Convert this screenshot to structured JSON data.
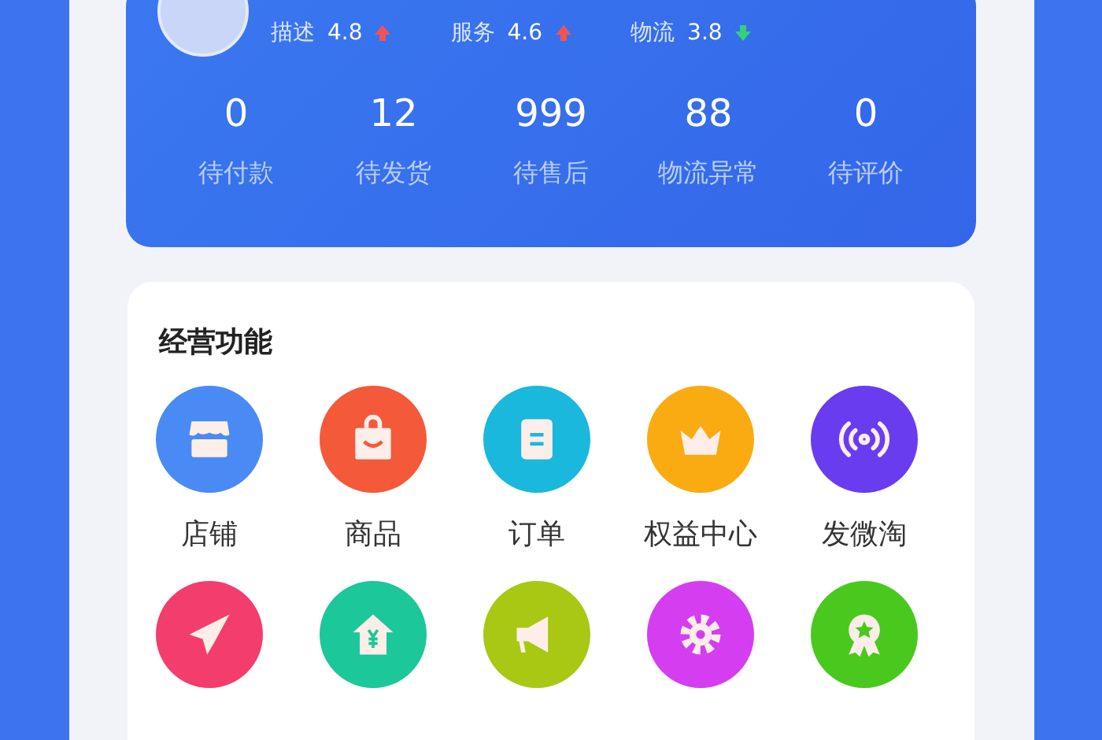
{
  "ratings": [
    {
      "label": "描述",
      "score": "4.8",
      "kind": "up"
    },
    {
      "label": "服务",
      "score": "4.6",
      "kind": "up"
    },
    {
      "label": "物流",
      "score": "3.8",
      "kind": "down"
    }
  ],
  "order_stats": [
    {
      "value": "0",
      "label": "待付款"
    },
    {
      "value": "12",
      "label": "待发货"
    },
    {
      "value": "999",
      "label": "待售后"
    },
    {
      "value": "88",
      "label": "物流异常"
    },
    {
      "value": "0",
      "label": "待评价"
    }
  ],
  "functions": {
    "title": "经营功能",
    "items": [
      {
        "kind": "store",
        "label": "店铺",
        "color": "#4a8af4"
      },
      {
        "kind": "bag",
        "label": "商品",
        "color": "#f4593a"
      },
      {
        "kind": "clipboard",
        "label": "订单",
        "color": "#19b8dc"
      },
      {
        "kind": "crown",
        "label": "权益中心",
        "color": "#fbab12"
      },
      {
        "kind": "broadcast",
        "label": "发微淘",
        "color": "#6a3cf0"
      },
      {
        "kind": "plane",
        "color": "#f33d6c"
      },
      {
        "kind": "house",
        "color": "#1cc79a"
      },
      {
        "kind": "megaphone",
        "color": "#a8c814"
      },
      {
        "kind": "gear",
        "color": "#d53ef0"
      },
      {
        "kind": "badge",
        "color": "#49c91e"
      }
    ]
  }
}
